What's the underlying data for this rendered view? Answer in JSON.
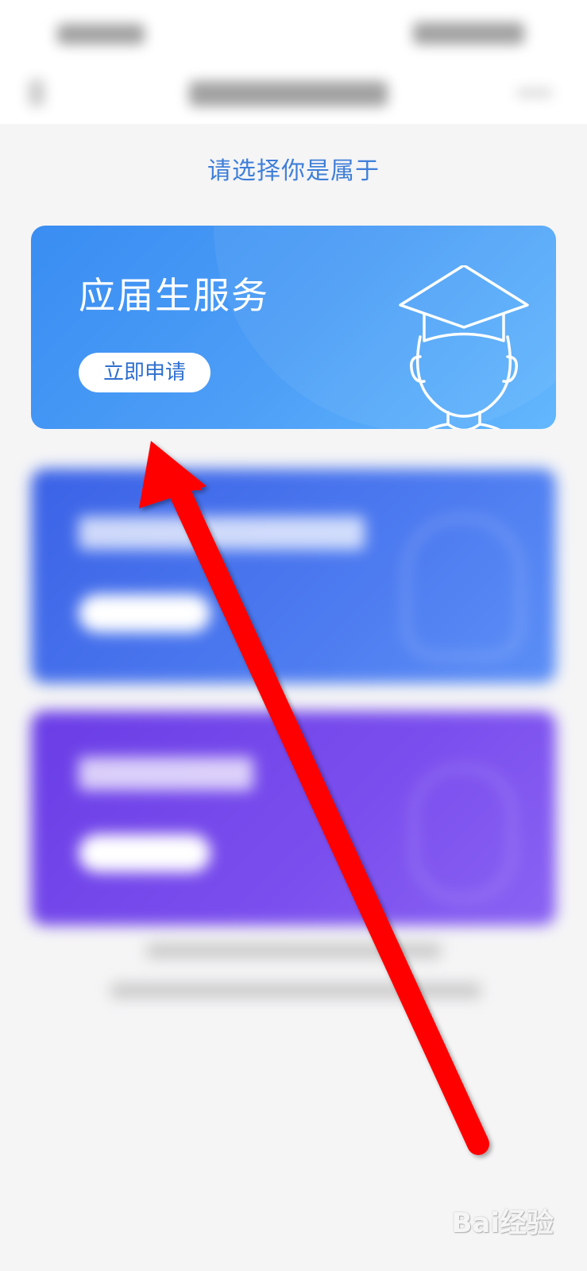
{
  "page": {
    "prompt": "请选择你是属于"
  },
  "cards": [
    {
      "title": "应届生服务",
      "button": "立即申请"
    }
  ],
  "watermark": {
    "text": "Bai经验"
  },
  "colors": {
    "prompt": "#3f7fd9",
    "card1": "#3a8df2",
    "card2": "#4d7bf0",
    "card3": "#7b4fee",
    "arrow": "#ff0000"
  }
}
